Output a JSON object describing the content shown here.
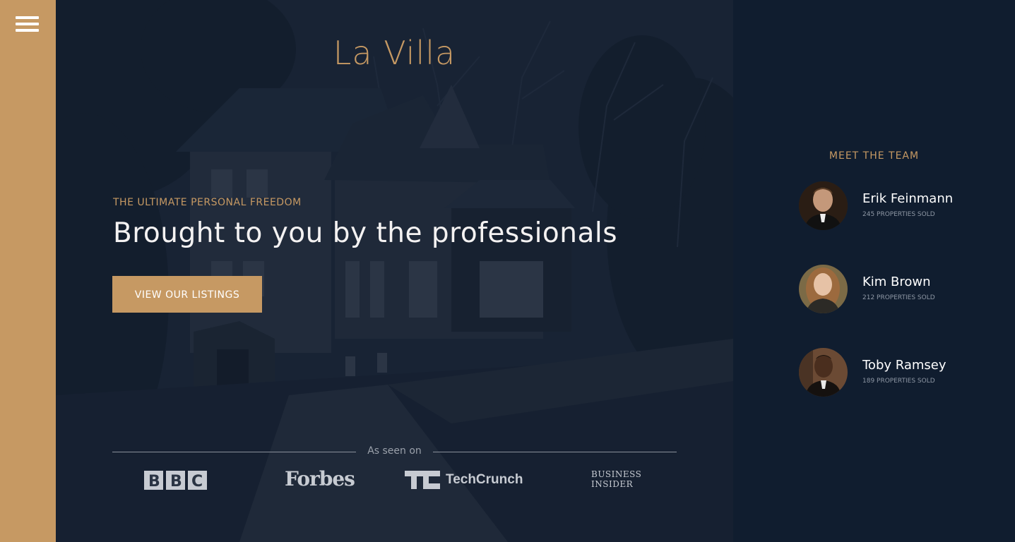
{
  "header": {
    "logo": "La Villa"
  },
  "hero": {
    "subtitle": "THE ULTIMATE PERSONAL FREEDOM",
    "headline": "Brought to you by the professionals",
    "cta_label": "VIEW OUR LISTINGS"
  },
  "press": {
    "label": "As seen on",
    "logos": [
      {
        "name": "BBC",
        "icon": "bbc-logo"
      },
      {
        "name": "Forbes",
        "icon": "forbes-logo"
      },
      {
        "name": "TechCrunch",
        "icon": "techcrunch-logo"
      },
      {
        "name": "BUSINESS INSIDER",
        "icon": "business-insider-logo"
      }
    ]
  },
  "team": {
    "title": "MEET THE TEAM",
    "members": [
      {
        "name": "Erik Feinmann",
        "stat": "245 PROPERTIES SOLD"
      },
      {
        "name": "Kim Brown",
        "stat": "212 PROPERTIES SOLD"
      },
      {
        "name": "Toby Ramsey",
        "stat": "189 PROPERTIES SOLD"
      }
    ]
  },
  "colors": {
    "primary": "#c69963",
    "dark": "#101d2f",
    "text_light": "#f4f2f2"
  }
}
